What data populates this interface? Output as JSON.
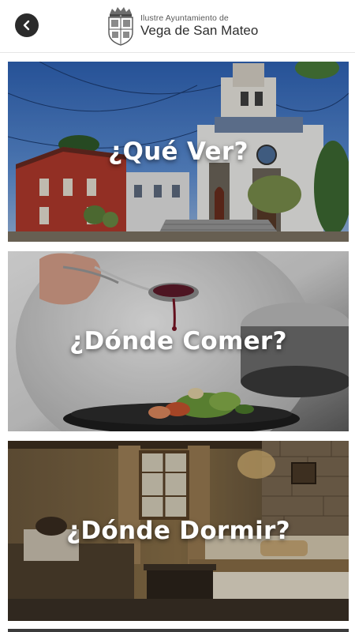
{
  "header": {
    "back_icon": "chevron-left-icon",
    "brand_line1": "Ilustre Ayuntamiento de",
    "brand_line2": "Vega de San Mateo",
    "crest_icon": "coat-of-arms-icon"
  },
  "cards": [
    {
      "title": "¿Qué Ver?",
      "image": "church-plaza-image"
    },
    {
      "title": "¿Dónde Comer?",
      "image": "chef-plating-image"
    },
    {
      "title": "¿Dónde Dormir?",
      "image": "rural-bedroom-image"
    }
  ]
}
